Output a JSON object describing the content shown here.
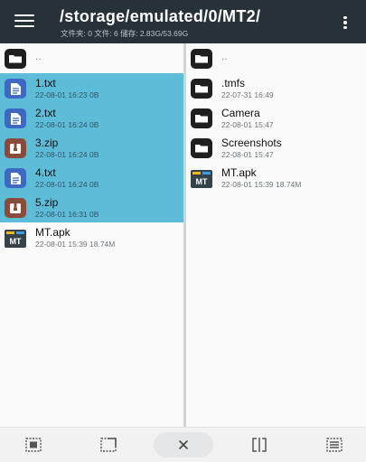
{
  "header": {
    "title": "/storage/emulated/0/MT2/",
    "info": "文件夹: 0  文件: 6  储存: 2.83G/53.69G",
    "menu_icon": "hamburger-menu-icon",
    "more_icon": "more-vert-icon"
  },
  "left_pane": {
    "parent_label": "..",
    "items": [
      {
        "name": "1.txt",
        "meta": "22-08-01 16:23  0B",
        "type": "txt",
        "selected": true
      },
      {
        "name": "2.txt",
        "meta": "22-08-01 16:24  0B",
        "type": "txt",
        "selected": true
      },
      {
        "name": "3.zip",
        "meta": "22-08-01 16:24  0B",
        "type": "zip",
        "selected": true
      },
      {
        "name": "4.txt",
        "meta": "22-08-01 16:24  0B",
        "type": "txt",
        "selected": true
      },
      {
        "name": "5.zip",
        "meta": "22-08-01 16:31  0B",
        "type": "zip",
        "selected": true
      },
      {
        "name": "MT.apk",
        "meta": "22-08-01 15:39  18.74M",
        "type": "apk",
        "selected": false
      }
    ]
  },
  "right_pane": {
    "parent_label": "..",
    "items": [
      {
        "name": ".tmfs",
        "meta": "22-07-31 16:49",
        "type": "folder"
      },
      {
        "name": "Camera",
        "meta": "22-08-01 15:47",
        "type": "folder"
      },
      {
        "name": "Screenshots",
        "meta": "22-08-01 15:47",
        "type": "folder"
      },
      {
        "name": "MT.apk",
        "meta": "22-08-01 15:39  18.74M",
        "type": "apk"
      }
    ]
  },
  "bottom_bar": {
    "tools": [
      "select-all-icon",
      "invert-selection-icon",
      "clear-selection-icon",
      "split-view-icon",
      "select-list-icon"
    ],
    "clear_label": "×"
  },
  "colors": {
    "header_bg": "#263238",
    "selection": "#5dbcd7",
    "txt_icon": "#3d68c4",
    "zip_icon": "#8b4b3a",
    "folder_icon": "#1f1f1f"
  }
}
